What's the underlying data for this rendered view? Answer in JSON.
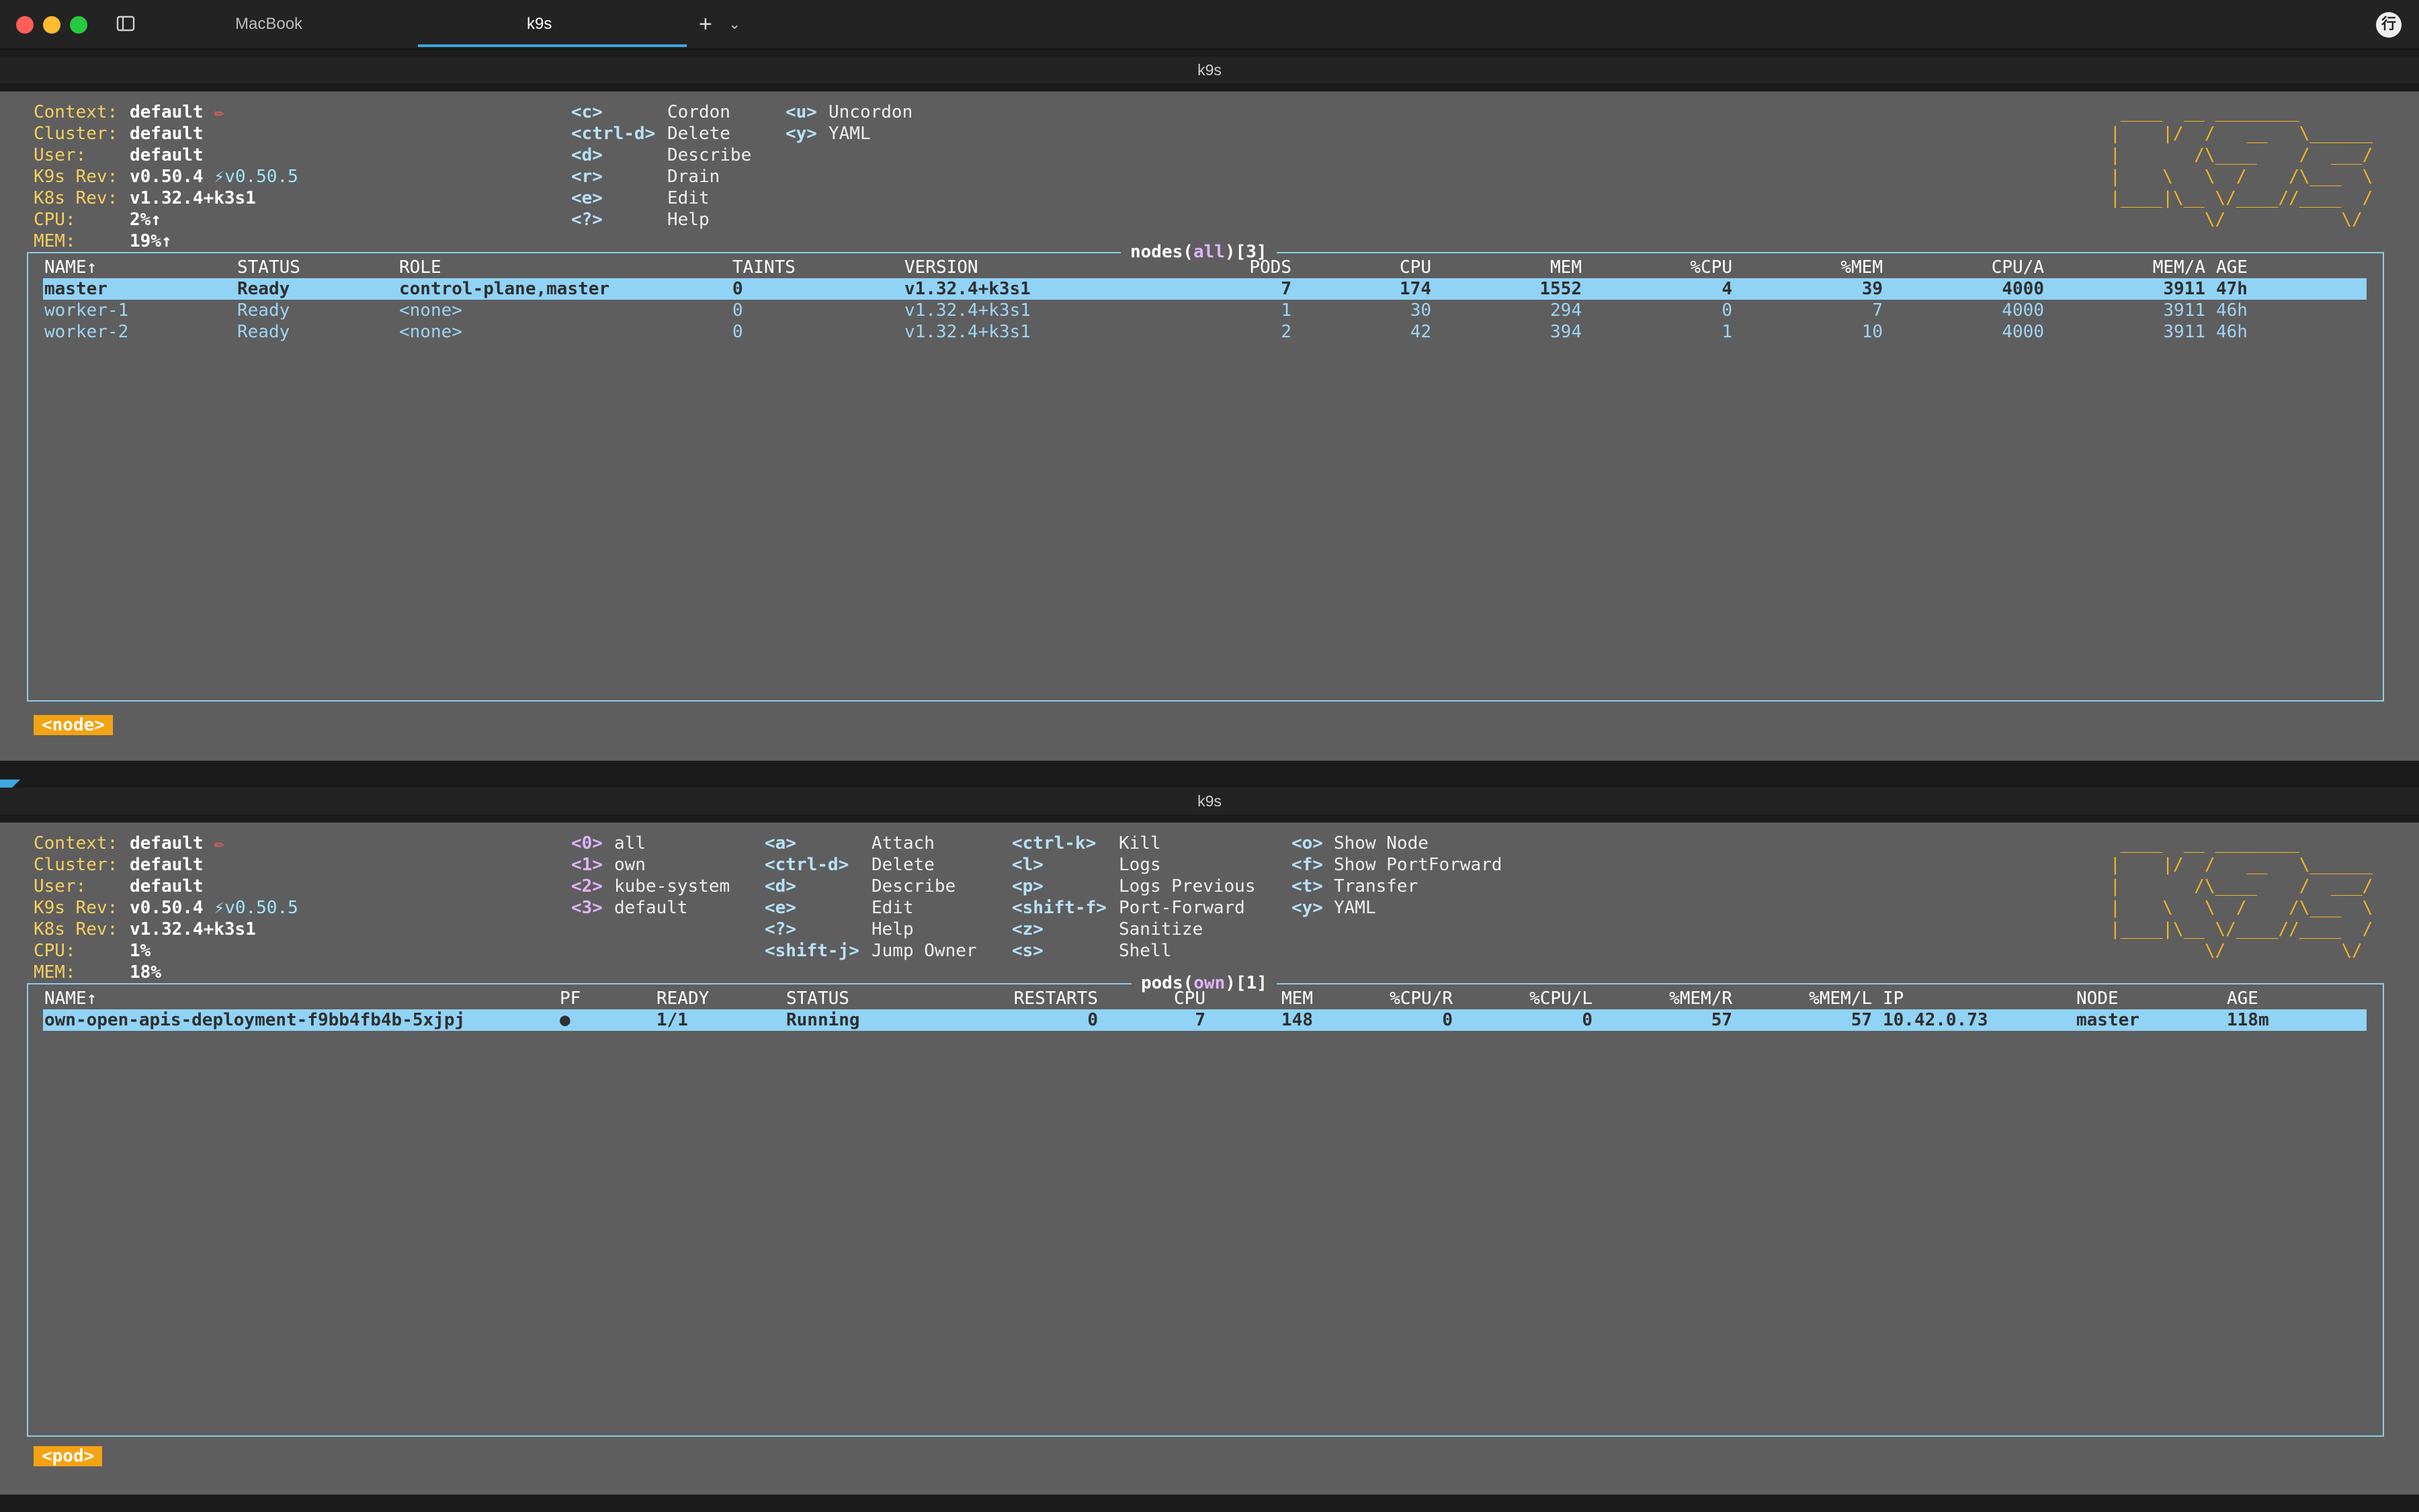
{
  "window": {
    "tabs": [
      "MacBook",
      "k9s"
    ],
    "active_tab": "k9s",
    "new_tab_glyph": "+",
    "tab_menu_glyph": "⌄",
    "profile_initial": "行",
    "colors": {
      "close": "#ff5f57",
      "minimize": "#febc2e",
      "zoom": "#28c840",
      "accent": "#3da8e0"
    }
  },
  "panes": [
    {
      "title": "k9s",
      "info": [
        {
          "label": "Context:",
          "value": "default",
          "suffix": " ✏"
        },
        {
          "label": "Cluster:",
          "value": "default",
          "suffix": ""
        },
        {
          "label": "User:",
          "value": "default",
          "suffix": ""
        },
        {
          "label": "K9s Rev:",
          "value": "v0.50.4",
          "suffix": " ⚡v0.50.5"
        },
        {
          "label": "K8s Rev:",
          "value": "v1.32.4+k3s1",
          "suffix": ""
        },
        {
          "label": "CPU:",
          "value": "2%↑",
          "suffix": ""
        },
        {
          "label": "MEM:",
          "value": "19%↑",
          "suffix": ""
        }
      ],
      "shortcuts": [
        [
          {
            "key": "<c>",
            "action": "Cordon"
          },
          {
            "key": "<ctrl-d>",
            "action": "Delete"
          },
          {
            "key": "<d>",
            "action": "Describe"
          },
          {
            "key": "<r>",
            "action": "Drain"
          },
          {
            "key": "<e>",
            "action": "Edit"
          },
          {
            "key": "<?>",
            "action": "Help"
          }
        ],
        [
          {
            "key": "<u>",
            "action": "Uncordon"
          },
          {
            "key": "<y>",
            "action": "YAML"
          }
        ]
      ],
      "table_title": {
        "resource": "nodes",
        "ns": "all",
        "count": "3"
      },
      "columns": [
        "NAME↑",
        "STATUS",
        "ROLE",
        "TAINTS",
        "VERSION",
        "PODS",
        "CPU",
        "MEM",
        "%CPU",
        "%MEM",
        "CPU/A",
        "MEM/A",
        "AGE"
      ],
      "rows": [
        [
          "master",
          "Ready",
          "control-plane,master",
          "0",
          "v1.32.4+k3s1",
          "7",
          "174",
          "1552",
          "4",
          "39",
          "4000",
          "3911",
          "47h"
        ],
        [
          "worker-1",
          "Ready",
          "<none>",
          "0",
          "v1.32.4+k3s1",
          "1",
          "30",
          "294",
          "0",
          "7",
          "4000",
          "3911",
          "46h"
        ],
        [
          "worker-2",
          "Ready",
          "<none>",
          "0",
          "v1.32.4+k3s1",
          "2",
          "42",
          "394",
          "1",
          "10",
          "4000",
          "3911",
          "46h"
        ]
      ],
      "crumb": "<node>"
    },
    {
      "title": "k9s",
      "info": [
        {
          "label": "Context:",
          "value": "default",
          "suffix": " ✏"
        },
        {
          "label": "Cluster:",
          "value": "default",
          "suffix": ""
        },
        {
          "label": "User:",
          "value": "default",
          "suffix": ""
        },
        {
          "label": "K9s Rev:",
          "value": "v0.50.4",
          "suffix": " ⚡v0.50.5"
        },
        {
          "label": "K8s Rev:",
          "value": "v1.32.4+k3s1",
          "suffix": ""
        },
        {
          "label": "CPU:",
          "value": "1%",
          "suffix": ""
        },
        {
          "label": "MEM:",
          "value": "18%",
          "suffix": ""
        }
      ],
      "namespaces": [
        {
          "key": "<0>",
          "name": "all"
        },
        {
          "key": "<1>",
          "name": "own"
        },
        {
          "key": "<2>",
          "name": "kube-system"
        },
        {
          "key": "<3>",
          "name": "default"
        }
      ],
      "shortcuts": [
        [
          {
            "key": "<a>",
            "action": "Attach"
          },
          {
            "key": "<ctrl-d>",
            "action": "Delete"
          },
          {
            "key": "<d>",
            "action": "Describe"
          },
          {
            "key": "<e>",
            "action": "Edit"
          },
          {
            "key": "<?>",
            "action": "Help"
          },
          {
            "key": "<shift-j>",
            "action": "Jump Owner"
          }
        ],
        [
          {
            "key": "<ctrl-k>",
            "action": "Kill"
          },
          {
            "key": "<l>",
            "action": "Logs"
          },
          {
            "key": "<p>",
            "action": "Logs Previous"
          },
          {
            "key": "<shift-f>",
            "action": "Port-Forward"
          },
          {
            "key": "<z>",
            "action": "Sanitize"
          },
          {
            "key": "<s>",
            "action": "Shell"
          }
        ],
        [
          {
            "key": "<o>",
            "action": "Show Node"
          },
          {
            "key": "<f>",
            "action": "Show PortForward"
          },
          {
            "key": "<t>",
            "action": "Transfer"
          },
          {
            "key": "<y>",
            "action": "YAML"
          }
        ]
      ],
      "table_title": {
        "resource": "pods",
        "ns": "own",
        "count": "1"
      },
      "columns": [
        "NAME↑",
        "PF",
        "READY",
        "STATUS",
        "RESTARTS",
        "CPU",
        "MEM",
        "%CPU/R",
        "%CPU/L",
        "%MEM/R",
        "%MEM/L",
        "IP",
        "NODE",
        "AGE"
      ],
      "rows": [
        [
          "own-open-apis-deployment-f9bb4fb4b-5xjpj",
          "●",
          "1/1",
          "Running",
          "0",
          "7",
          "148",
          "0",
          "0",
          "57",
          "57",
          "10.42.0.73",
          "master",
          "118m"
        ]
      ],
      "crumb": "<pod>"
    }
  ],
  "logo_lines": [
    " ____  __ ________       ",
    "|    |/  /   __   \\______",
    "|       /\\____    /  ___/",
    "|    \\   \\  /    /\\___  \\",
    "|____|\\__ \\/____//____  /",
    "         \\/           \\/ "
  ]
}
